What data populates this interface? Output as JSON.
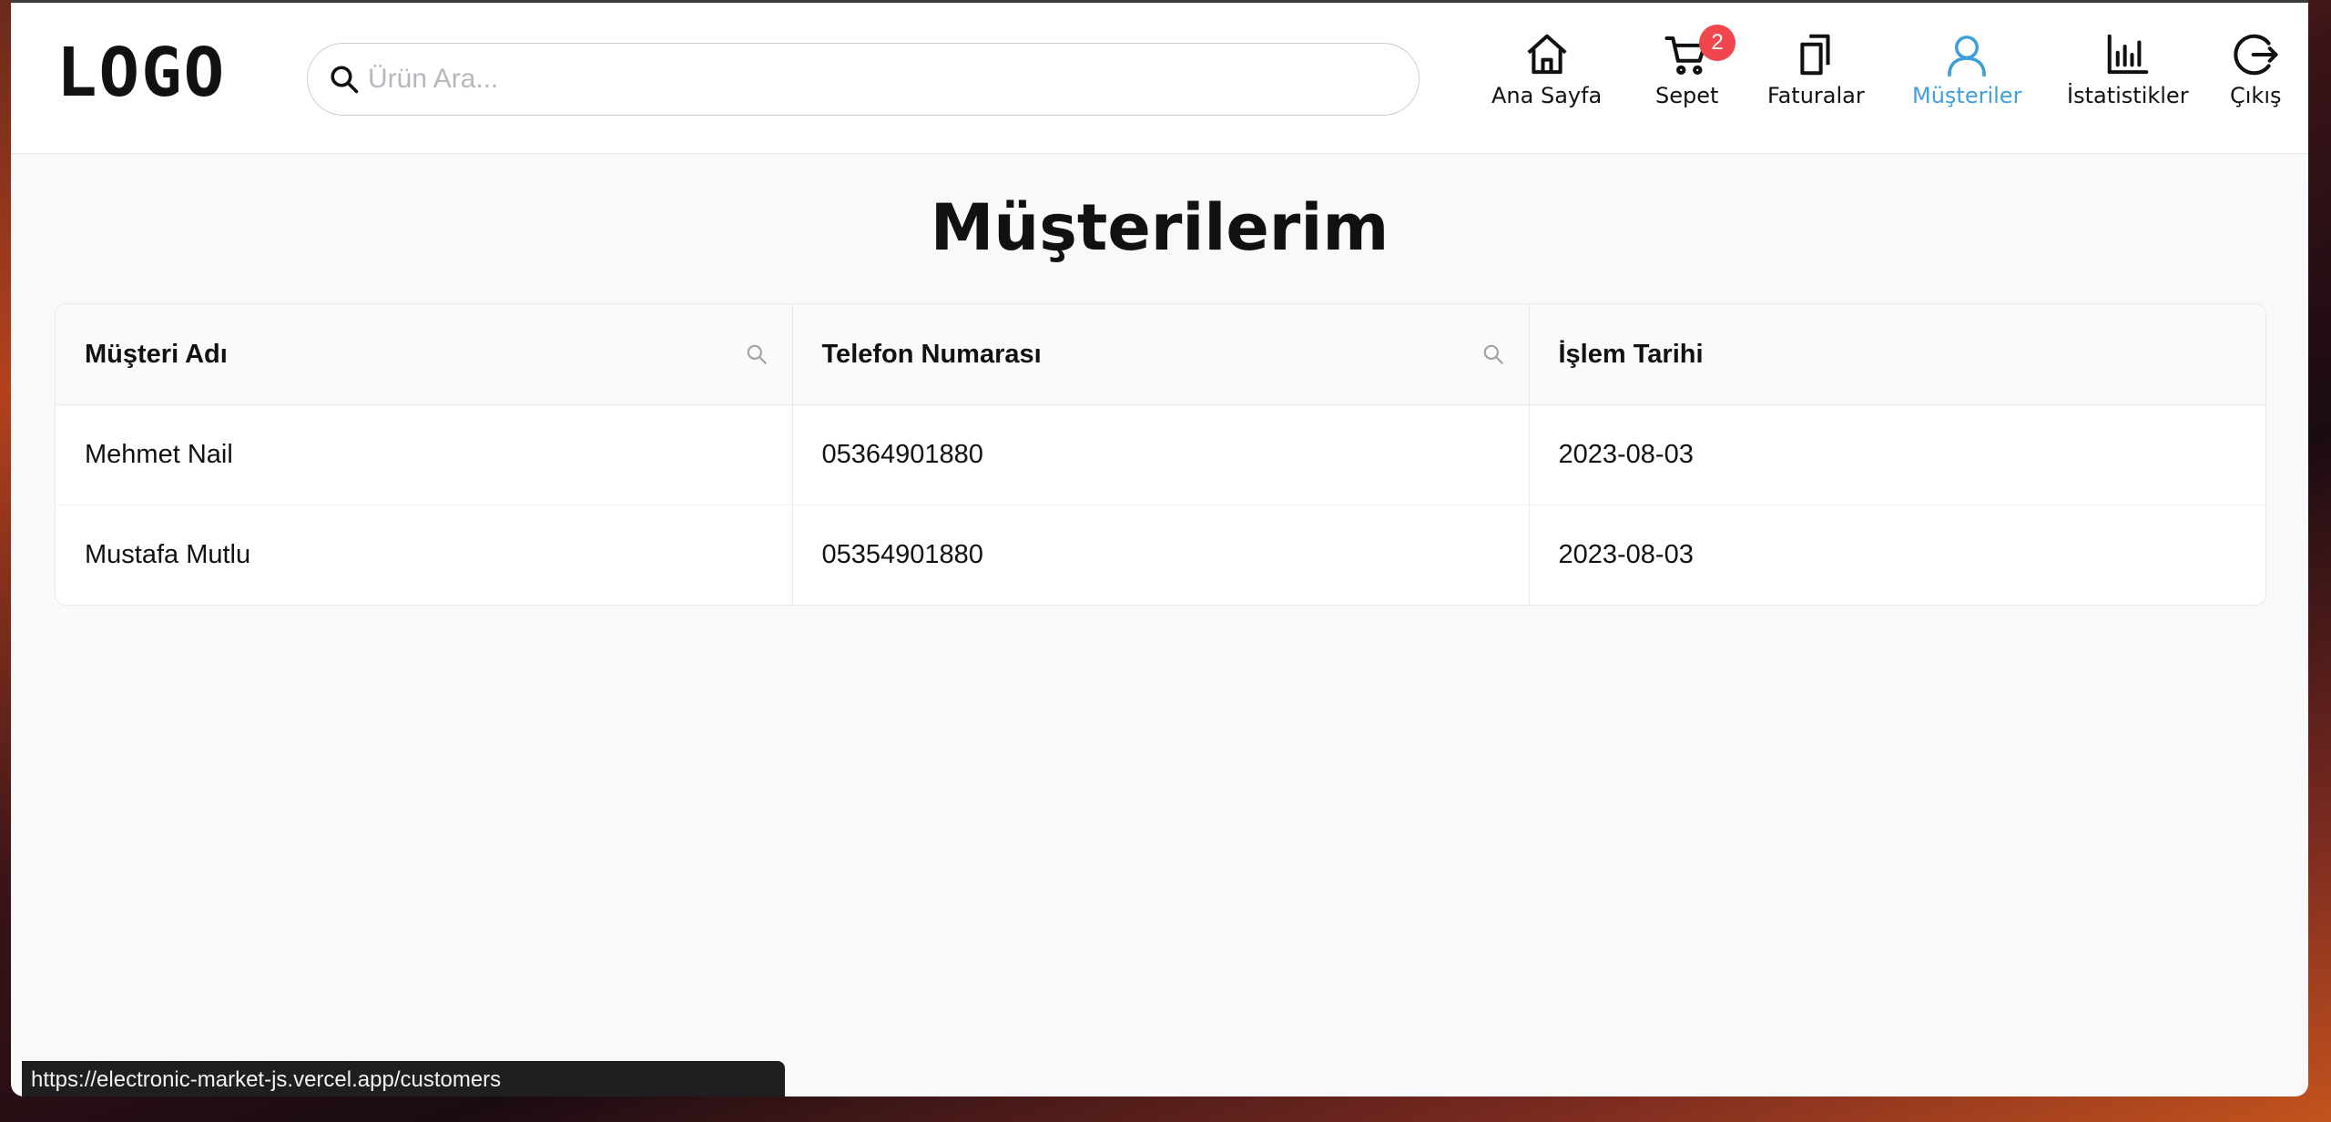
{
  "header": {
    "logo": "LOGO",
    "search_placeholder": "Ürün Ara...",
    "search_value": ""
  },
  "nav": [
    {
      "label": "Ana Sayfa",
      "icon": "home-icon",
      "active": false
    },
    {
      "label": "Sepet",
      "icon": "cart-icon",
      "badge": "2",
      "active": false
    },
    {
      "label": "Faturalar",
      "icon": "documents-icon",
      "active": false
    },
    {
      "label": "Müşteriler",
      "icon": "user-icon",
      "active": true
    },
    {
      "label": "İstatistikler",
      "icon": "bar-chart-icon",
      "active": false
    },
    {
      "label": "Çıkış",
      "icon": "logout-icon",
      "active": false
    }
  ],
  "colors": {
    "active": "#3ea0dd",
    "badge": "#f0474f"
  },
  "page": {
    "title": "Müşterilerim"
  },
  "table": {
    "columns": [
      "Müşteri Adı",
      "Telefon Numarası",
      "İşlem Tarihi"
    ],
    "rows": [
      [
        "Mehmet Nail",
        "05364901880",
        "2023-08-03"
      ],
      [
        "Mustafa Mutlu",
        "05354901880",
        "2023-08-03"
      ]
    ]
  },
  "status_bar": {
    "url": "https://electronic-market-js.vercel.app/customers"
  }
}
